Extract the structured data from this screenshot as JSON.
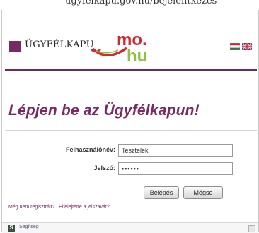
{
  "top_strip": {
    "text": "ugyfelkapu.gov.hu/bejelentkezes"
  },
  "header": {
    "brand": "ÜGYFÉLKAPU",
    "logo_mo": "mo.",
    "logo_hu": "hu",
    "languages": [
      "hu",
      "en"
    ]
  },
  "login": {
    "heading": "Lépjen be az Ügyfélkapun!",
    "username_label": "Felhasználónév:",
    "username_value": "Tesztelek",
    "password_label": "Jelszó:",
    "password_value": "••••••",
    "login_button": "Belépés",
    "cancel_button": "Mégse",
    "register_link": "Még nem regisztrált?",
    "separator": "|",
    "forgot_link": "Elfelejtette a jelszavát?"
  },
  "footer": {
    "help_icon": "S",
    "help_label": "Segítség"
  },
  "colors": {
    "brand_purple": "#7a2a62",
    "logo_green": "#8ac43f",
    "logo_red": "#d6262e"
  }
}
